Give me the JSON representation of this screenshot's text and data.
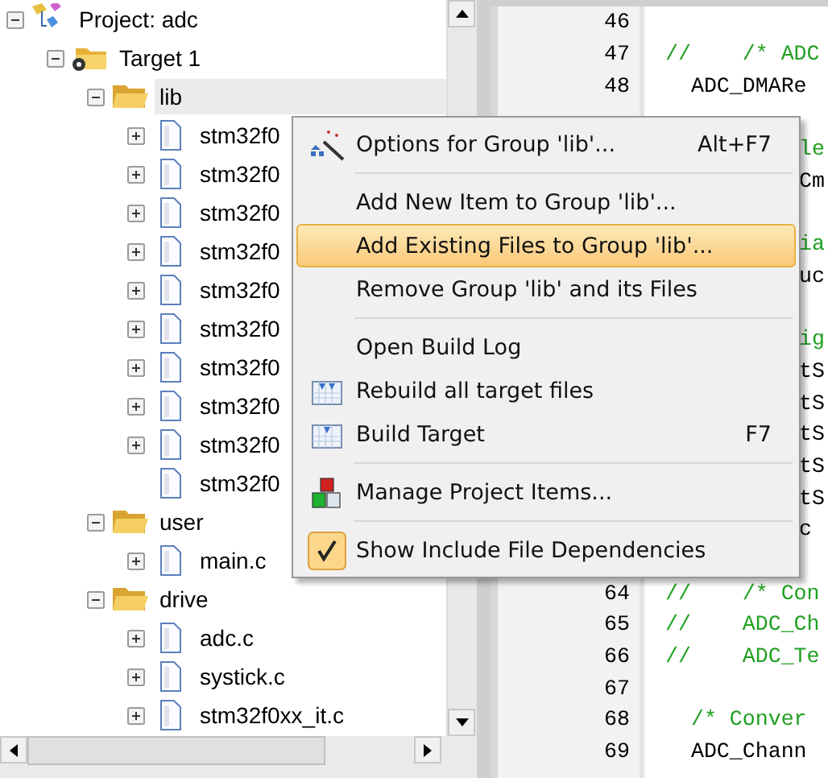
{
  "tree": [
    {
      "kind": "project",
      "label": "Project: adc",
      "expanded": true,
      "selected": false,
      "children": [
        {
          "kind": "target",
          "label": "Target 1",
          "expanded": true,
          "selected": false,
          "children": [
            {
              "kind": "group",
              "label": "lib",
              "expanded": true,
              "selected": true,
              "children": [
                {
                  "kind": "file",
                  "label": "stm32f0",
                  "expanded": false,
                  "selected": false
                },
                {
                  "kind": "file",
                  "label": "stm32f0",
                  "expanded": false,
                  "selected": false
                },
                {
                  "kind": "file",
                  "label": "stm32f0",
                  "expanded": false,
                  "selected": false
                },
                {
                  "kind": "file",
                  "label": "stm32f0",
                  "expanded": false,
                  "selected": false
                },
                {
                  "kind": "file",
                  "label": "stm32f0",
                  "expanded": false,
                  "selected": false
                },
                {
                  "kind": "file",
                  "label": "stm32f0",
                  "expanded": false,
                  "selected": false
                },
                {
                  "kind": "file",
                  "label": "stm32f0",
                  "expanded": false,
                  "selected": false
                },
                {
                  "kind": "file",
                  "label": "stm32f0",
                  "expanded": false,
                  "selected": false
                },
                {
                  "kind": "file",
                  "label": "stm32f0",
                  "expanded": false,
                  "selected": false
                },
                {
                  "kind": "file",
                  "label": "stm32f0",
                  "selected": false
                }
              ]
            },
            {
              "kind": "group",
              "label": "user",
              "expanded": true,
              "selected": false,
              "children": [
                {
                  "kind": "file",
                  "label": "main.c",
                  "expanded": false,
                  "selected": false
                }
              ]
            },
            {
              "kind": "group",
              "label": "drive",
              "expanded": true,
              "selected": false,
              "children": [
                {
                  "kind": "file",
                  "label": "adc.c",
                  "expanded": false,
                  "selected": false
                },
                {
                  "kind": "file",
                  "label": "systick.c",
                  "expanded": false,
                  "selected": false
                },
                {
                  "kind": "file",
                  "label": "stm32f0xx_it.c",
                  "expanded": false,
                  "selected": false
                }
              ]
            }
          ]
        }
      ]
    }
  ],
  "editor": {
    "lines": [
      {
        "kind": "blank",
        "number": "46"
      },
      {
        "kind": "comment",
        "number": "47",
        "text": "//    /* ADC"
      },
      {
        "kind": "code",
        "number": "48",
        "text": "  ADC_DMARe"
      },
      {
        "kind": "covered"
      },
      {
        "kind": "comment_covered",
        "text": "le"
      },
      {
        "kind": "code_covered",
        "text": "Cm"
      },
      {
        "kind": "covered"
      },
      {
        "kind": "comment_covered",
        "text": "ia"
      },
      {
        "kind": "code_covered",
        "text": "uc"
      },
      {
        "kind": "covered"
      },
      {
        "kind": "comment_covered",
        "text": "ig"
      },
      {
        "kind": "code_covered",
        "text": "tS"
      },
      {
        "kind": "code_covered",
        "text": "tS"
      },
      {
        "kind": "code_covered",
        "text": "tS"
      },
      {
        "kind": "code_covered",
        "text": "tS"
      },
      {
        "kind": "code_covered",
        "text": "tS"
      },
      {
        "kind": "code_covered",
        "text": "c"
      },
      {
        "kind": "covered"
      },
      {
        "kind": "comment",
        "number": "64",
        "text": "//    /* Con"
      },
      {
        "kind": "comment",
        "number": "65",
        "text": "//    ADC_Ch"
      },
      {
        "kind": "comment",
        "number": "66",
        "text": "//    ADC_Te"
      },
      {
        "kind": "blank",
        "number": "67"
      },
      {
        "kind": "comment",
        "number": "68",
        "text": "  /* Conver"
      },
      {
        "kind": "code",
        "number": "69",
        "text": "  ADC_Chann"
      }
    ]
  },
  "context_menu": {
    "items": [
      {
        "kind": "item",
        "label": "Options for Group 'lib'...",
        "shortcut": "Alt+F7",
        "selected": false,
        "checked": false
      },
      {
        "kind": "separator"
      },
      {
        "kind": "item",
        "label": "Add New  Item to Group 'lib'...",
        "selected": false,
        "checked": false
      },
      {
        "kind": "item",
        "label": "Add Existing Files to Group 'lib'...",
        "selected": true,
        "checked": false
      },
      {
        "kind": "item",
        "label": "Remove Group 'lib' and its Files",
        "selected": false,
        "checked": false
      },
      {
        "kind": "separator"
      },
      {
        "kind": "item",
        "label": "Open Build Log",
        "selected": false,
        "checked": false
      },
      {
        "kind": "item",
        "label": "Rebuild all target files",
        "selected": false,
        "checked": false
      },
      {
        "kind": "item",
        "label": "Build Target",
        "shortcut": "F7",
        "selected": false,
        "checked": false
      },
      {
        "kind": "separator"
      },
      {
        "kind": "item",
        "label": "Manage Project Items...",
        "selected": false,
        "checked": false
      },
      {
        "kind": "separator"
      },
      {
        "kind": "item",
        "label": "Show Include File Dependencies",
        "selected": false,
        "checked": true
      }
    ]
  }
}
